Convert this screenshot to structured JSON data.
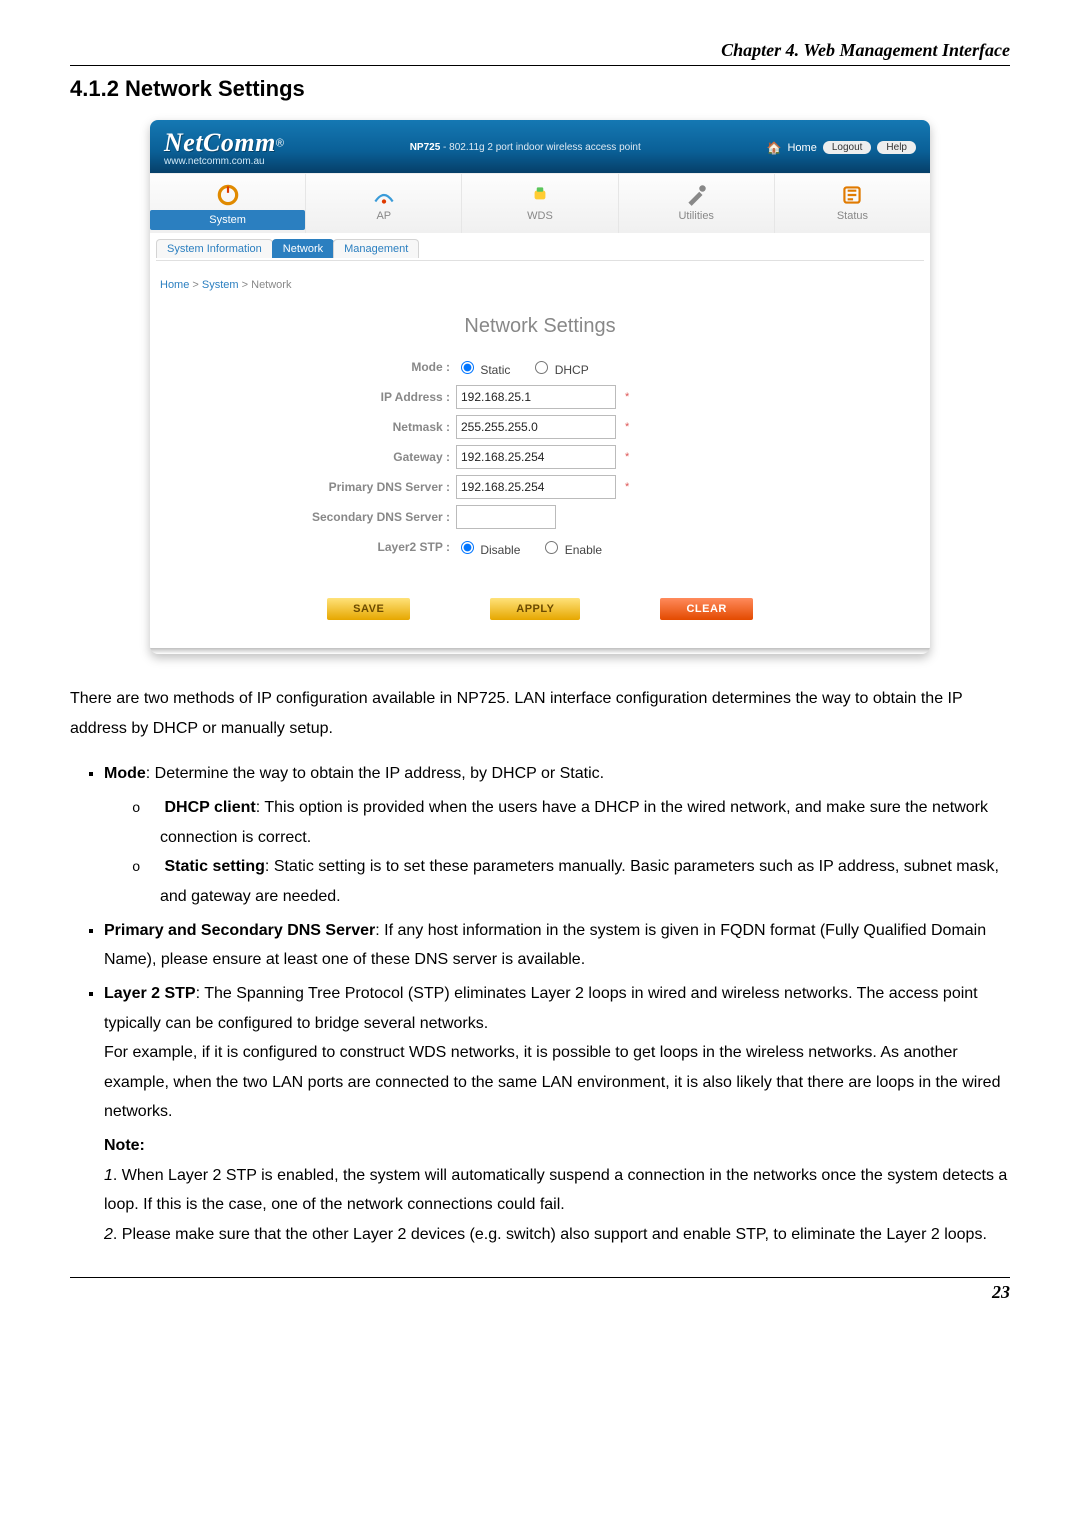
{
  "doc": {
    "chapter_header": "Chapter 4. Web Management Interface",
    "section_number_title": "4.1.2  Network Settings",
    "page_number": "23"
  },
  "shot": {
    "brand": {
      "name": "NetComm",
      "reg": "®",
      "url": "www.netcomm.com.au"
    },
    "model": "NP725",
    "model_desc": " - 802.11g 2 port indoor wireless access point",
    "header_links": {
      "home": "Home",
      "logout": "Logout",
      "help": "Help"
    },
    "main_tabs": [
      {
        "label": "System",
        "active": true
      },
      {
        "label": "AP",
        "active": false
      },
      {
        "label": "WDS",
        "active": false
      },
      {
        "label": "Utilities",
        "active": false
      },
      {
        "label": "Status",
        "active": false
      }
    ],
    "sub_tabs": [
      {
        "label": "System Information",
        "active": false
      },
      {
        "label": "Network",
        "active": true
      },
      {
        "label": "Management",
        "active": false
      }
    ],
    "breadcrumb": {
      "p1": "Home",
      "sep": " > ",
      "p2": "System",
      "p3": "Network"
    },
    "panel_title": "Network Settings",
    "form": {
      "mode": {
        "label": "Mode :",
        "opt_static": "Static",
        "opt_dhcp": "DHCP",
        "selected": "static"
      },
      "ip_address": {
        "label": "IP Address :",
        "value": "192.168.25.1",
        "required": true
      },
      "netmask": {
        "label": "Netmask :",
        "value": "255.255.255.0",
        "required": true
      },
      "gateway": {
        "label": "Gateway :",
        "value": "192.168.25.254",
        "required": true
      },
      "primary_dns": {
        "label": "Primary DNS Server :",
        "value": "192.168.25.254",
        "required": true
      },
      "secondary_dns": {
        "label": "Secondary DNS Server :",
        "value": "",
        "required": false
      },
      "layer2_stp": {
        "label": "Layer2 STP :",
        "opt_disable": "Disable",
        "opt_enable": "Enable",
        "selected": "disable"
      }
    },
    "buttons": {
      "save": "SAVE",
      "apply": "APPLY",
      "clear": "CLEAR"
    }
  },
  "text": {
    "intro": "There are two methods of IP configuration available in NP725. LAN interface configuration determines the way to obtain the IP address by DHCP or manually setup.",
    "mode_b": "Mode",
    "mode_t": ": Determine the way to obtain the IP address, by DHCP or Static.",
    "dhcp_b": "DHCP client",
    "dhcp_t": ": This option is provided when the users have a DHCP in the wired network, and make sure the network connection is correct.",
    "static_b": "Static setting",
    "static_t": ": Static setting is to set these parameters manually. Basic parameters such as IP address, subnet mask, and gateway are needed.",
    "dns_b": "Primary and Secondary DNS Server",
    "dns_t": ": If any host information in the system is given in FQDN format (Fully Qualified Domain Name), please ensure at least one of these DNS server is available.",
    "stp_b": "Layer 2 STP",
    "stp_t1": ": The Spanning Tree Protocol (STP) eliminates Layer 2 loops in wired and wireless networks. The access point typically can be configured to bridge several networks.",
    "stp_t2": "For example, if it is configured to construct WDS networks, it is possible to get loops in the wireless networks. As another example, when the two LAN ports are connected to the same LAN environment, it is also likely that there are loops in the wired networks.",
    "note_label": "Note:",
    "note1_num": "1",
    "note1": ". When Layer 2 STP is enabled, the system will automatically suspend a connection in the networks once the system detects a loop. If this is the case, one of the network connections could fail.",
    "note2_num": "2",
    "note2": ". Please make sure that the other Layer 2 devices (e.g. switch) also support and enable STP, to eliminate the Layer 2 loops."
  }
}
